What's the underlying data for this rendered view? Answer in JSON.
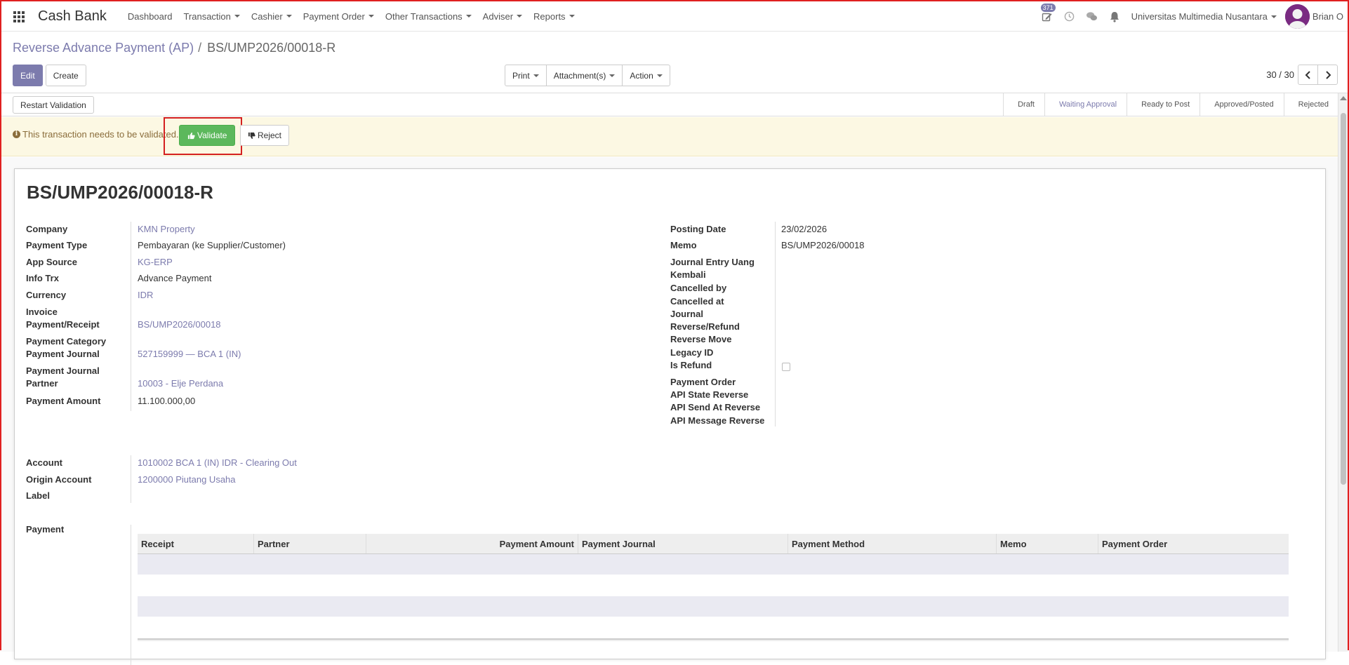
{
  "navbar": {
    "app_title": "Cash Bank",
    "menu": [
      {
        "label": "Dashboard",
        "dropdown": false
      },
      {
        "label": "Transaction",
        "dropdown": true
      },
      {
        "label": "Cashier",
        "dropdown": true
      },
      {
        "label": "Payment Order",
        "dropdown": true
      },
      {
        "label": "Other Transactions",
        "dropdown": true
      },
      {
        "label": "Adviser",
        "dropdown": true
      },
      {
        "label": "Reports",
        "dropdown": true
      }
    ],
    "activity_count": "371",
    "company": "Universitas Multimedia Nusantara",
    "user": "Brian O"
  },
  "breadcrumb": {
    "parent": "Reverse Advance Payment (AP)",
    "separator": "/",
    "current": "BS/UMP2026/00018-R"
  },
  "buttons": {
    "edit": "Edit",
    "create": "Create",
    "print": "Print",
    "attachments": "Attachment(s)",
    "action": "Action",
    "restart_validation": "Restart Validation",
    "validate": "Validate",
    "reject": "Reject"
  },
  "pager": {
    "value": "30 / 30"
  },
  "stages": [
    {
      "label": "Draft",
      "active": false
    },
    {
      "label": "Waiting Approval",
      "active": true
    },
    {
      "label": "Ready to Post",
      "active": false
    },
    {
      "label": "Approved/Posted",
      "active": false
    },
    {
      "label": "Rejected",
      "active": false
    }
  ],
  "alert": {
    "text": "This transaction needs to be validated."
  },
  "record": {
    "title": "BS/UMP2026/00018-R",
    "left_fields": {
      "company_label": "Company",
      "company_value": "KMN Property",
      "payment_type_label": "Payment Type",
      "payment_type_value": "Pembayaran (ke Supplier/Customer)",
      "app_source_label": "App Source",
      "app_source_value": "KG-ERP",
      "info_trx_label": "Info Trx",
      "info_trx_value": "Advance Payment",
      "currency_label": "Currency",
      "currency_value": "IDR",
      "invoice_label_1": "Invoice",
      "invoice_label_2": "Payment/Receipt",
      "invoice_value": "BS/UMP2026/00018",
      "pay_cat_label_1": "Payment Category",
      "pay_cat_label_2": "Payment Journal",
      "pay_cat_value": "527159999 — BCA 1 (IN)",
      "pj_partner_label_1": "Payment Journal",
      "pj_partner_label_2": "Partner",
      "pj_partner_value": "10003 - Elje Perdana",
      "amount_label": "Payment Amount",
      "amount_value": "11.100.000,00"
    },
    "right_fields": {
      "posting_date_label": "Posting Date",
      "posting_date_value": "23/02/2026",
      "memo_label": "Memo",
      "memo_value": "BS/UMP2026/00018",
      "je_label_1": "Journal Entry Uang",
      "je_label_2": "Kembali",
      "cancelled_by_label": "Cancelled by",
      "cancelled_at_label": "Cancelled at",
      "journal_label_1": "Journal",
      "journal_label_2": "Reverse/Refund",
      "reverse_move_label": "Reverse Move",
      "legacy_id_label": "Legacy ID",
      "is_refund_label": "Is Refund",
      "payment_order_label": "Payment Order",
      "api_state_label": "API State Reverse",
      "api_send_label": "API Send At Reverse",
      "api_msg_label": "API Message Reverse"
    },
    "account_fields": {
      "account_label": "Account",
      "account_value": "1010002 BCA 1 (IN) IDR - Clearing Out",
      "origin_label": "Origin Account",
      "origin_value": "1200000 Piutang Usaha",
      "label_label": "Label"
    },
    "payment_section_label": "Payment",
    "payment_columns": [
      "Receipt",
      "Partner",
      "Payment Amount",
      "Payment Journal",
      "Payment Method",
      "Memo",
      "Payment Order"
    ]
  }
}
